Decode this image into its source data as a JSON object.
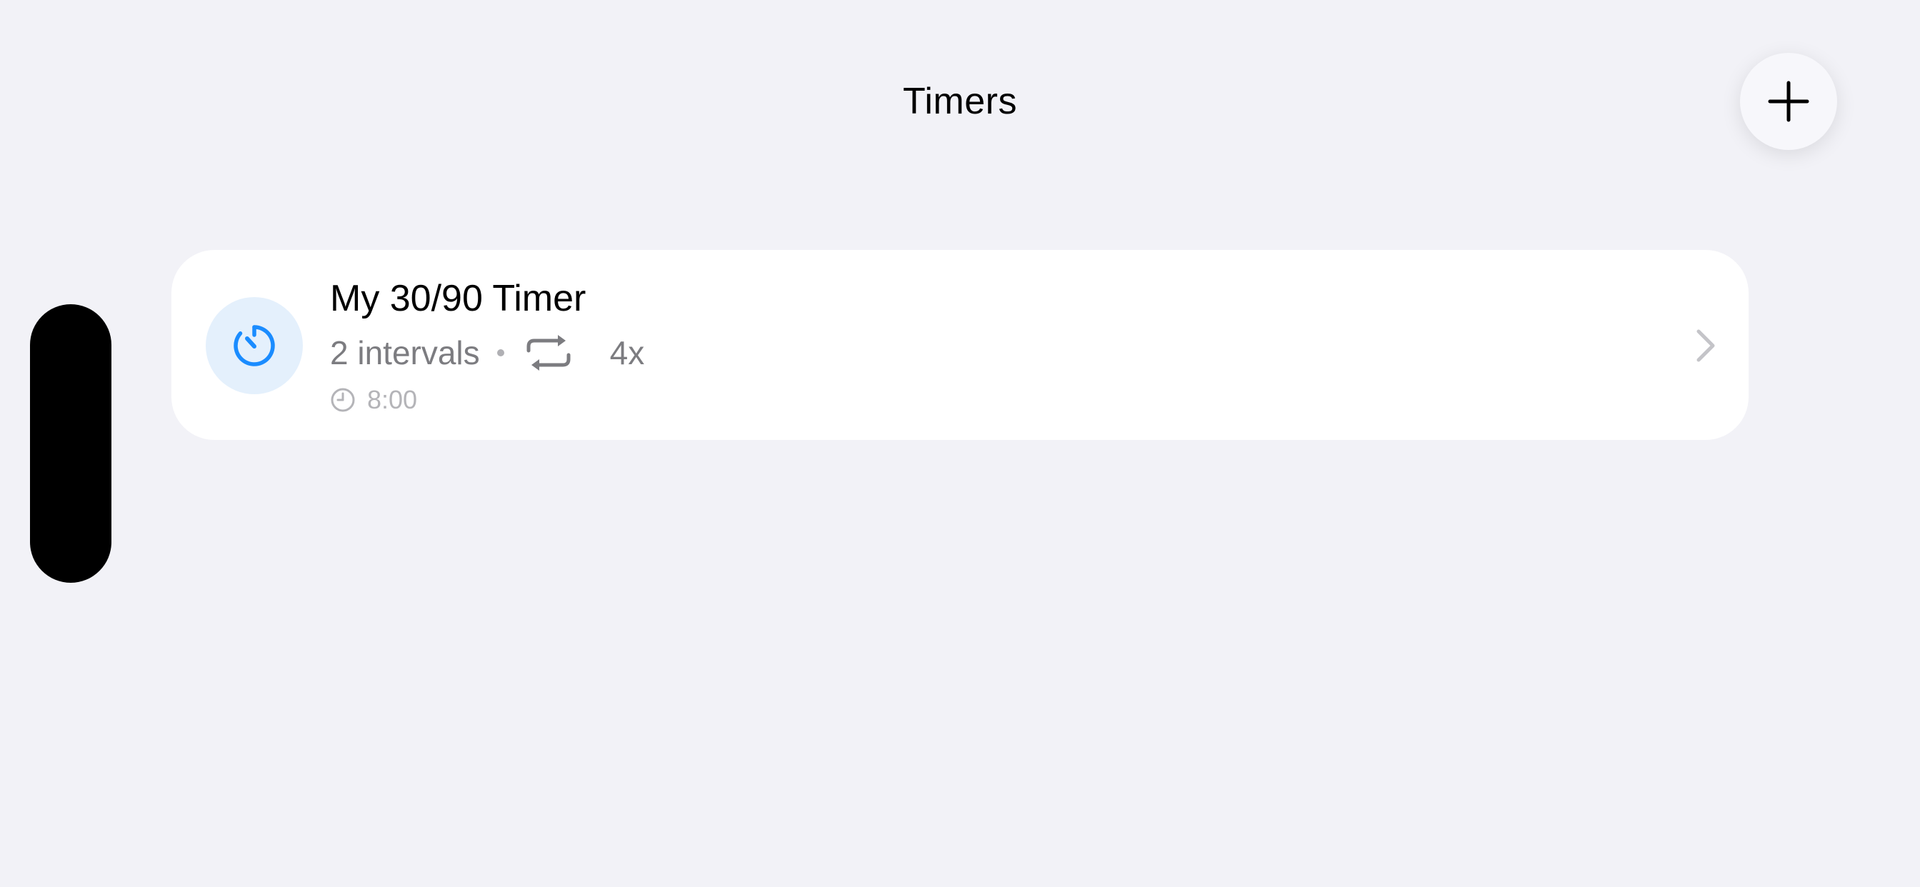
{
  "header": {
    "title": "Timers",
    "add_icon": "plus-icon"
  },
  "timers": [
    {
      "name": "My 30/90 Timer",
      "intervals": "2 intervals",
      "repeat_count": "4x",
      "duration": "8:00",
      "icon": "timer-icon",
      "icon_color": "#1a8cff",
      "icon_background": "#e4f0fc"
    }
  ],
  "colors": {
    "background": "#f2f2f7",
    "card": "#ffffff",
    "accent": "#1a8cff",
    "secondary_text": "#7c7c80",
    "tertiary_text": "#b4b4b8"
  }
}
